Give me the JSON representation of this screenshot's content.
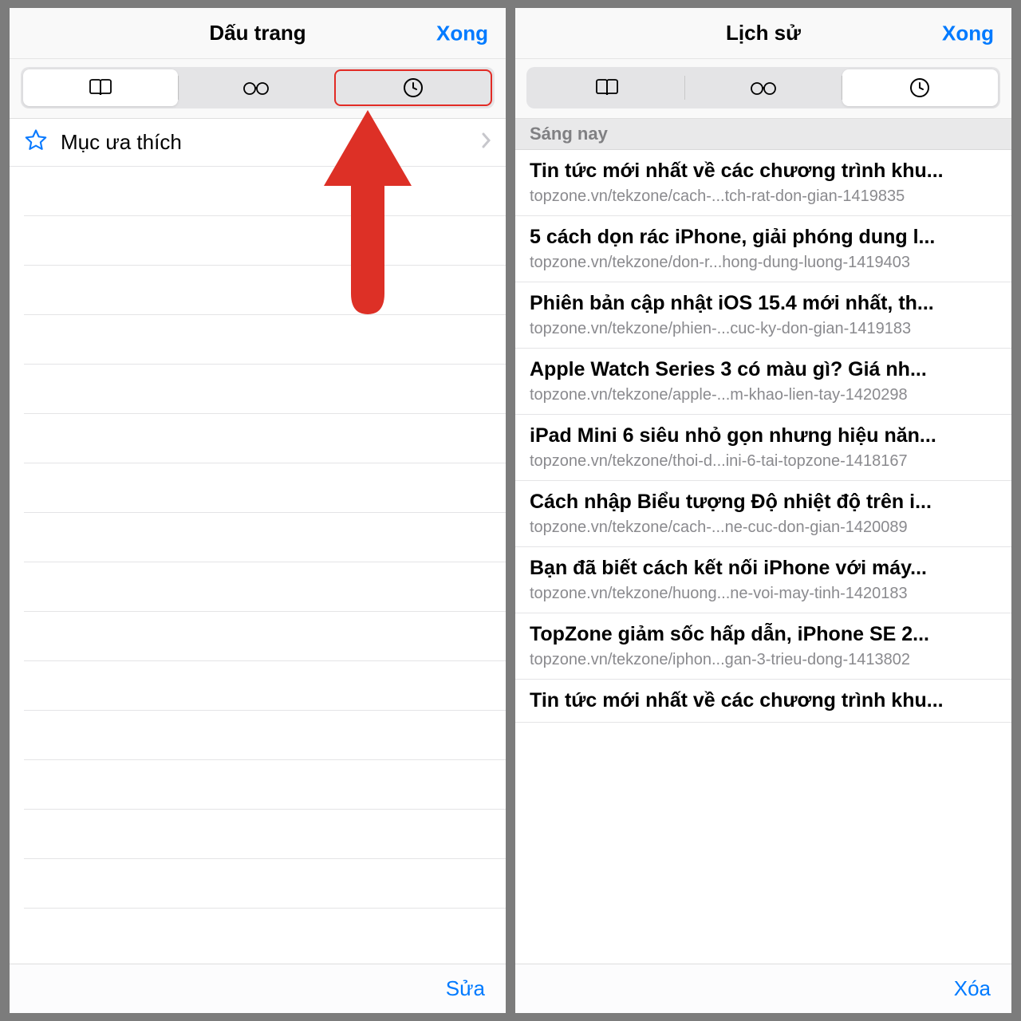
{
  "left": {
    "title": "Dấu trang",
    "done": "Xong",
    "favorites_label": "Mục ưa thích",
    "edit": "Sửa"
  },
  "right": {
    "title": "Lịch sử",
    "done": "Xong",
    "section_header": "Sáng nay",
    "clear": "Xóa",
    "history": [
      {
        "title": "Tin tức mới nhất về các chương trình khu...",
        "url": "topzone.vn/tekzone/cach-...tch-rat-don-gian-1419835"
      },
      {
        "title": "5 cách dọn rác iPhone, giải phóng dung l...",
        "url": "topzone.vn/tekzone/don-r...hong-dung-luong-1419403"
      },
      {
        "title": "Phiên bản cập nhật iOS 15.4 mới nhất, th...",
        "url": "topzone.vn/tekzone/phien-...cuc-ky-don-gian-1419183"
      },
      {
        "title": "Apple Watch Series 3 có màu gì? Giá nh...",
        "url": "topzone.vn/tekzone/apple-...m-khao-lien-tay-1420298"
      },
      {
        "title": "iPad Mini 6 siêu nhỏ gọn nhưng hiệu năn...",
        "url": "topzone.vn/tekzone/thoi-d...ini-6-tai-topzone-1418167"
      },
      {
        "title": "Cách nhập Biểu tượng Độ nhiệt độ trên i...",
        "url": "topzone.vn/tekzone/cach-...ne-cuc-don-gian-1420089"
      },
      {
        "title": "Bạn đã biết cách kết nối iPhone với máy...",
        "url": "topzone.vn/tekzone/huong...ne-voi-may-tinh-1420183"
      },
      {
        "title": "TopZone giảm sốc hấp dẫn, iPhone SE 2...",
        "url": "topzone.vn/tekzone/iphon...gan-3-trieu-dong-1413802"
      },
      {
        "title": "Tin tức mới nhất về các chương trình khu...",
        "url": ""
      }
    ]
  },
  "colors": {
    "accent": "#007aff",
    "annotation": "#dd3026"
  }
}
